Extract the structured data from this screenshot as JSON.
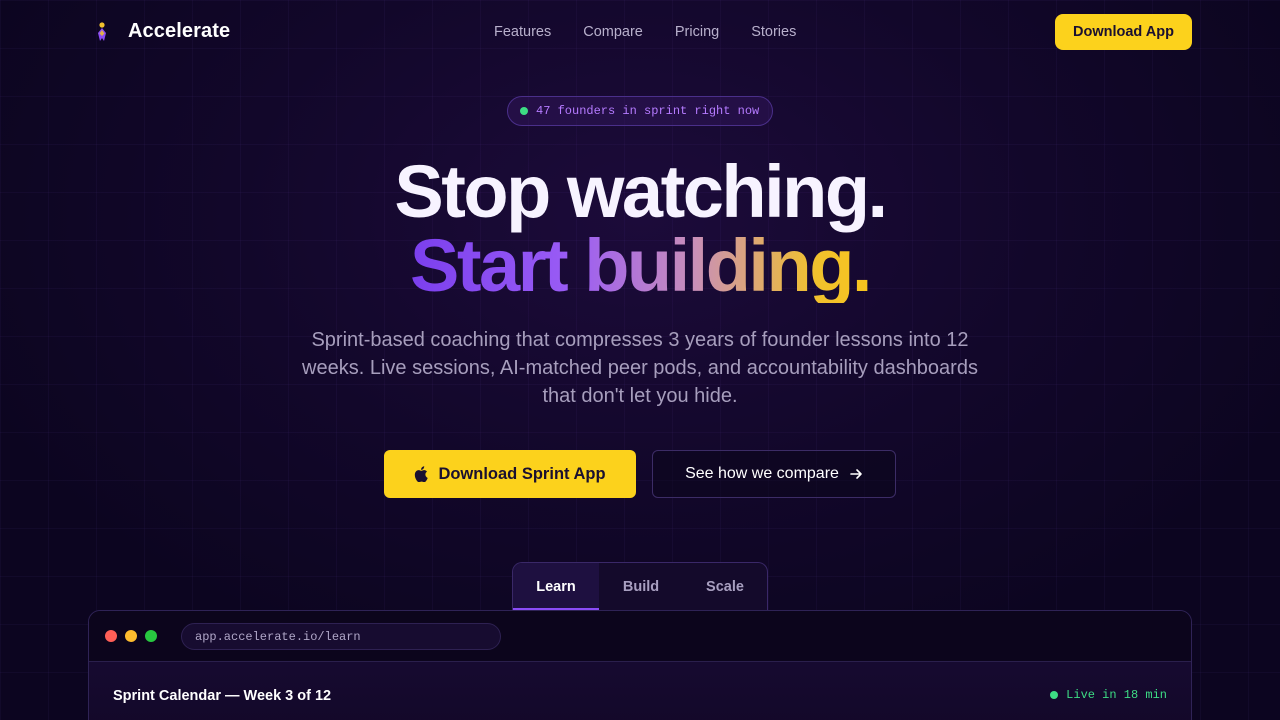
{
  "nav": {
    "brand_name": "Accelerate",
    "links": [
      "Features",
      "Compare",
      "Pricing",
      "Stories"
    ],
    "cta_label": "Download App"
  },
  "badge": {
    "text": "47 founders in sprint right now"
  },
  "hero": {
    "headline_line1": "Stop watching.",
    "headline_line2": "Start building.",
    "subtitle": "Sprint-based coaching that compresses 3 years of founder lessons into 12 weeks. Live sessions, AI-matched peer pods, and accountability dashboards that don't let you hide.",
    "primary_cta": "Download Sprint App",
    "secondary_cta": "See how we compare"
  },
  "tabs": {
    "items": [
      "Learn",
      "Build",
      "Scale"
    ],
    "active": "Learn"
  },
  "app_window": {
    "url": "app.accelerate.io/learn",
    "calendar_title": "Sprint Calendar — Week 3 of 12",
    "live_status": "Live in 18 min"
  },
  "colors": {
    "accent_yellow": "#fcd21c",
    "accent_purple": "#8b4cf7",
    "status_green": "#3ddc84",
    "background": "#0c0520"
  },
  "icons": {
    "brand": "rocket-logo-icon",
    "primary_cta": "apple-icon",
    "secondary_cta": "arrow-right-icon",
    "badge": "live-dot-icon"
  }
}
